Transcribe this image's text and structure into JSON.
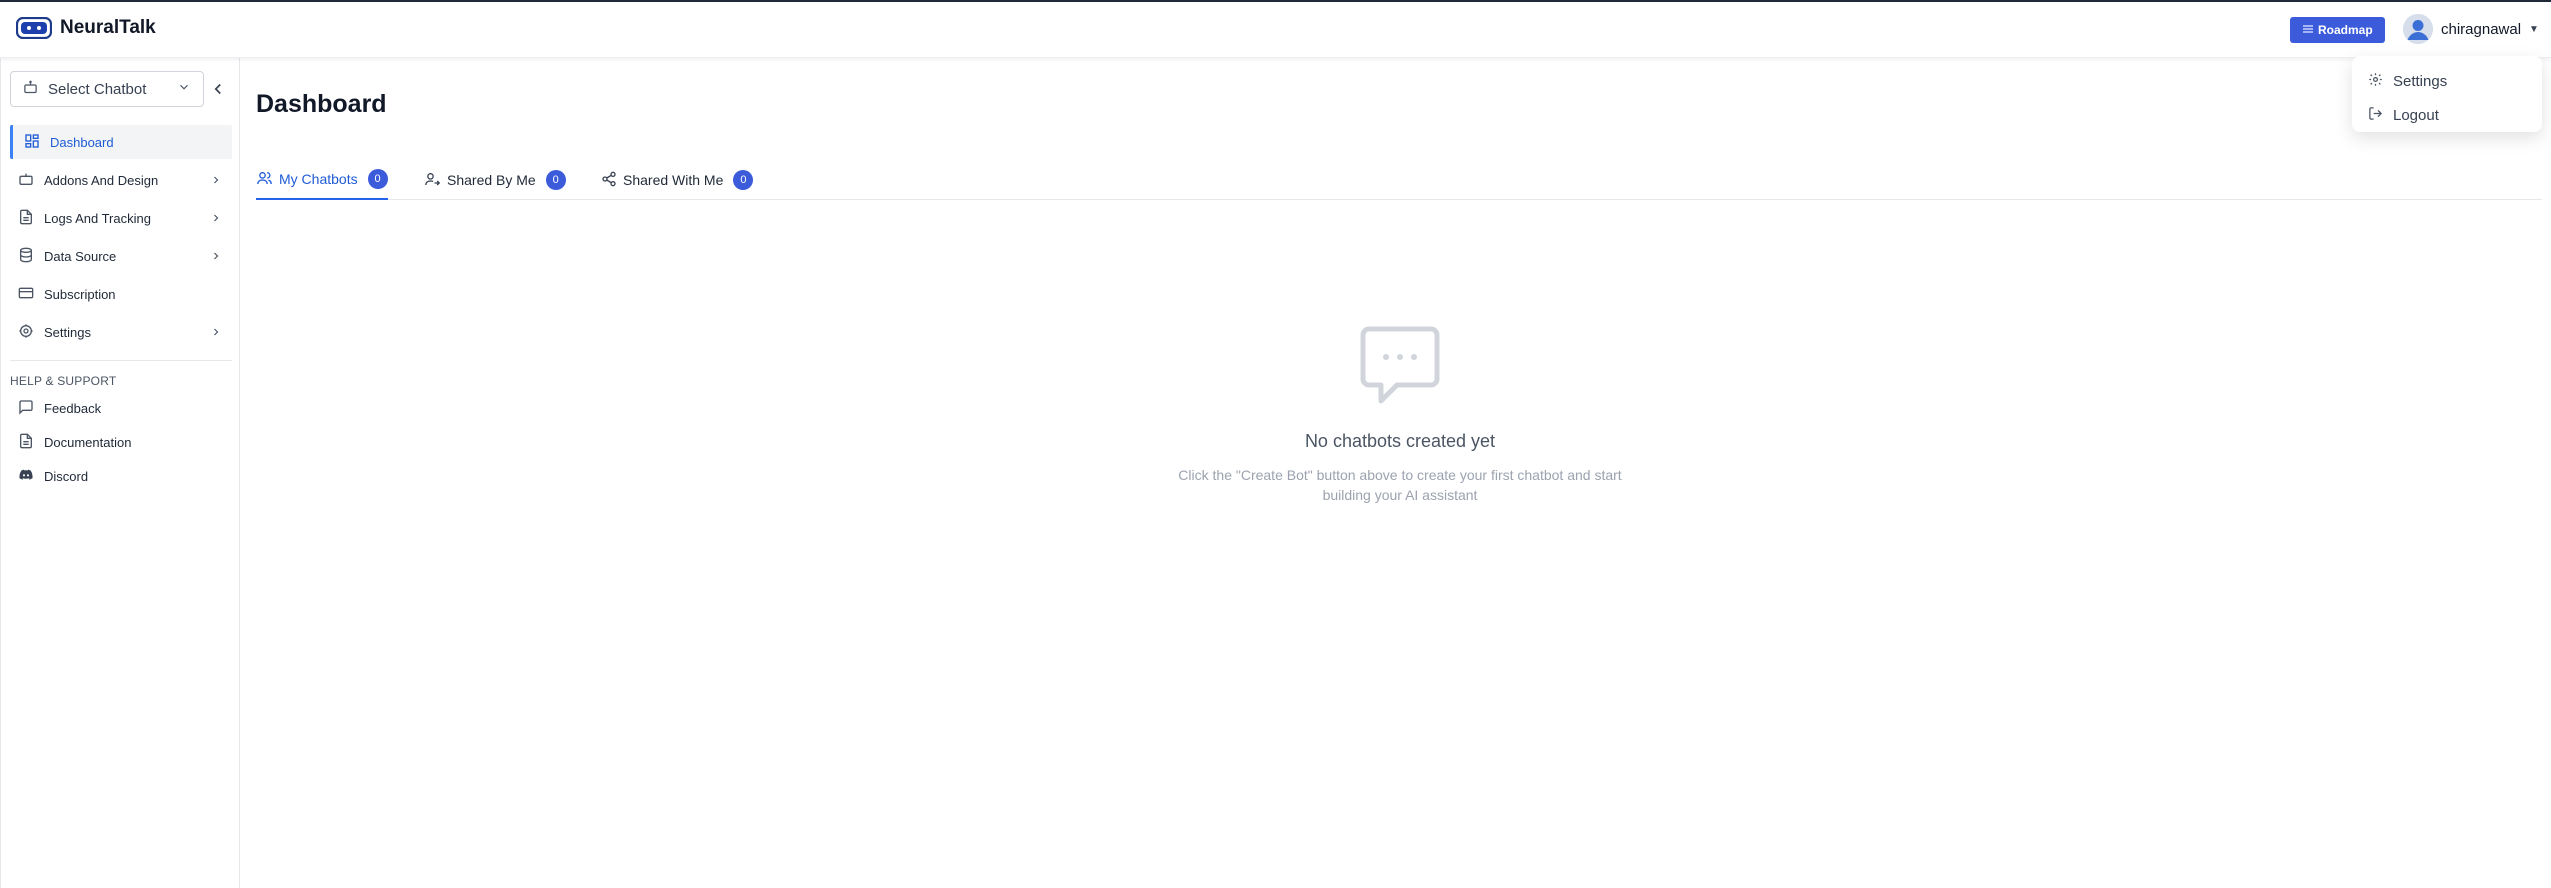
{
  "brand": {
    "name": "NeuralTalk"
  },
  "header": {
    "roadmap_label": "Roadmap",
    "username": "chiragnawal"
  },
  "user_menu": {
    "items": [
      {
        "label": "Settings",
        "icon": "gear-icon"
      },
      {
        "label": "Logout",
        "icon": "logout-icon"
      }
    ]
  },
  "sidebar": {
    "select_placeholder": "Select Chatbot",
    "items": [
      {
        "label": "Dashboard",
        "icon": "grid-icon",
        "active": true
      },
      {
        "label": "Addons And Design",
        "icon": "bot-icon",
        "expandable": true
      },
      {
        "label": "Logs And Tracking",
        "icon": "document-icon",
        "expandable": true
      },
      {
        "label": "Data Source",
        "icon": "database-icon",
        "expandable": true
      },
      {
        "label": "Subscription",
        "icon": "card-icon"
      },
      {
        "label": "Settings",
        "icon": "gear-icon",
        "expandable": true
      }
    ],
    "help_title": "HELP & SUPPORT",
    "help_items": [
      {
        "label": "Feedback",
        "icon": "message-icon"
      },
      {
        "label": "Documentation",
        "icon": "document-icon"
      },
      {
        "label": "Discord",
        "icon": "discord-icon"
      }
    ]
  },
  "main": {
    "title": "Dashboard",
    "tabs": [
      {
        "label": "My Chatbots",
        "count": "0",
        "active": true
      },
      {
        "label": "Shared By Me",
        "count": "0"
      },
      {
        "label": "Shared With Me",
        "count": "0"
      }
    ],
    "empty_state": {
      "title": "No chatbots created yet",
      "description": "Click the \"Create Bot\" button above to create your first chatbot and start building your AI assistant"
    }
  },
  "colors": {
    "accent": "#3b5bdb",
    "active_text": "#1e5bd6",
    "badge": "#3b5bdb"
  }
}
